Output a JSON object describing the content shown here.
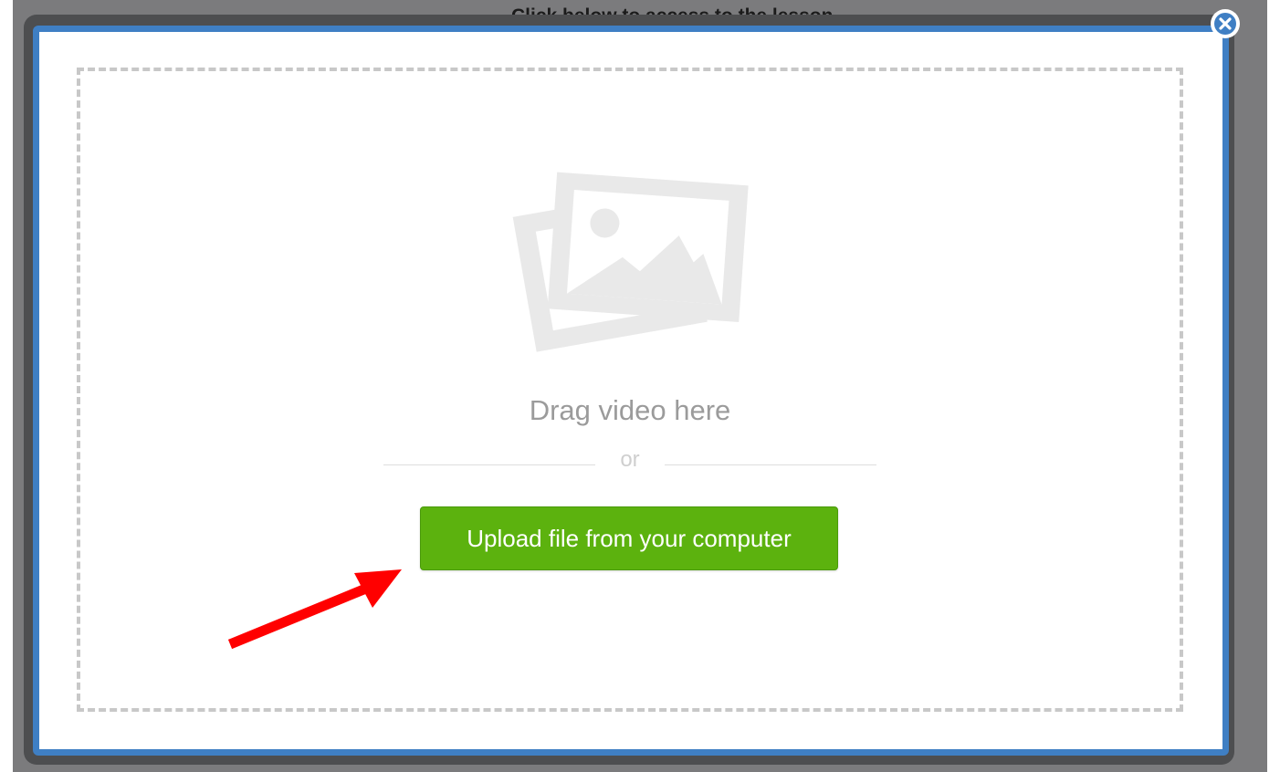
{
  "background": {
    "heading": "Click below to access to the lesson"
  },
  "modal": {
    "close_icon": "close-circle-icon",
    "dropzone": {
      "icon": "photo-placeholder-icon",
      "drag_text": "Drag video here",
      "or_text": "or",
      "upload_button_label": "Upload file from your computer"
    }
  },
  "annotation": {
    "arrow_icon": "red-arrow-icon"
  },
  "colors": {
    "modal_border": "#3f7fc4",
    "upload_button": "#5cb20e",
    "dropzone_border": "#c8c8c8",
    "annotation_arrow": "#ff0000"
  }
}
